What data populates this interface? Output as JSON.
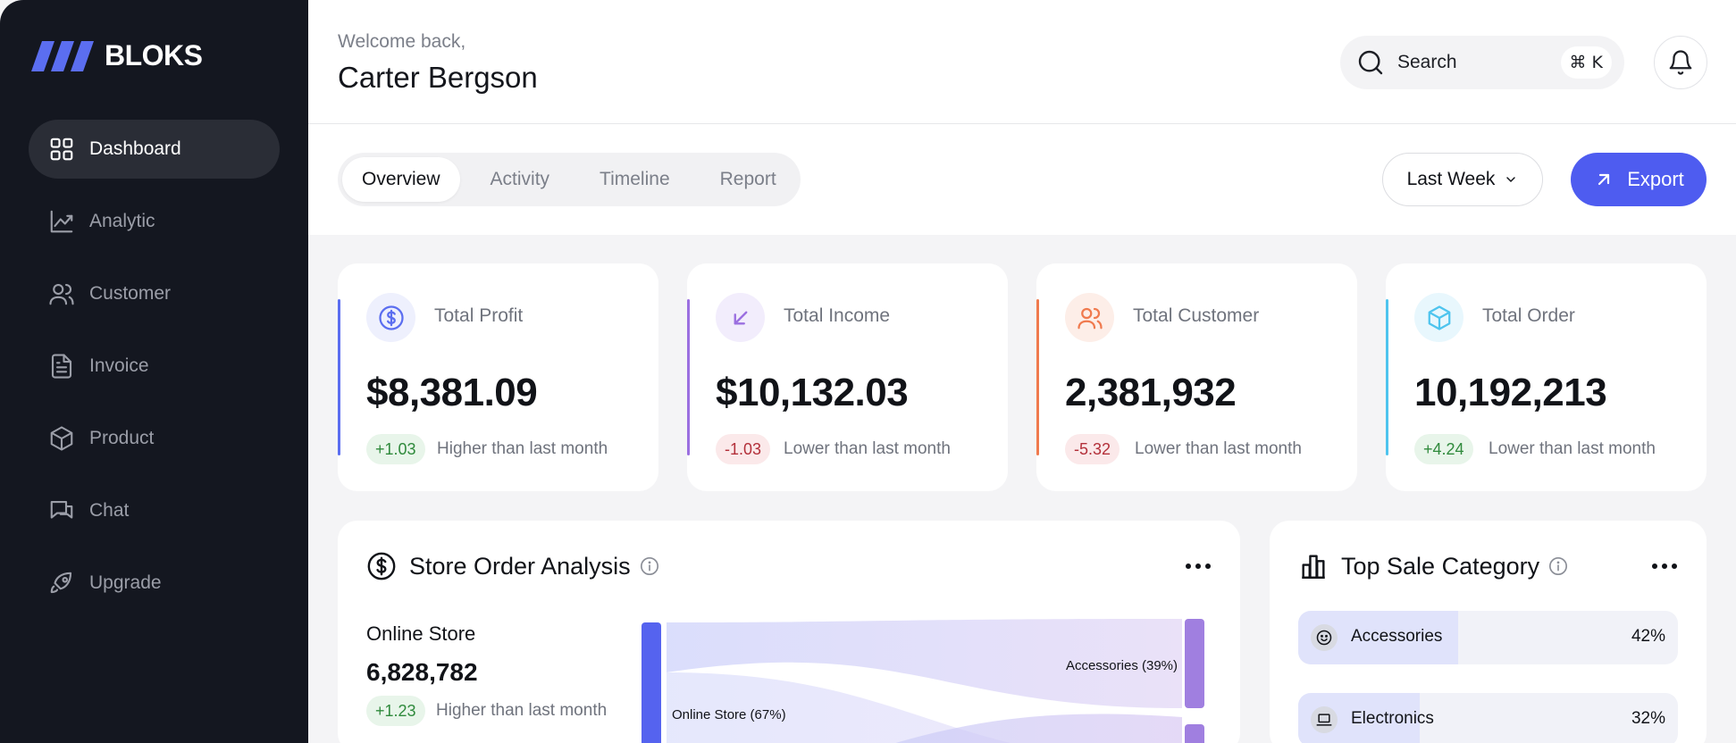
{
  "app": {
    "logo_text": "BLOKS",
    "brand_color": "#4e5cf0"
  },
  "sidebar": {
    "items": [
      {
        "label": "Dashboard",
        "icon": "grid-icon",
        "active": true
      },
      {
        "label": "Analytic",
        "icon": "trend-icon"
      },
      {
        "label": "Customer",
        "icon": "users-icon"
      },
      {
        "label": "Invoice",
        "icon": "document-icon"
      },
      {
        "label": "Product",
        "icon": "box-icon"
      },
      {
        "label": "Chat",
        "icon": "chat-icon"
      },
      {
        "label": "Upgrade",
        "icon": "rocket-icon"
      }
    ]
  },
  "header": {
    "welcome": "Welcome back,",
    "user_name": "Carter Bergson",
    "search_label": "Search",
    "search_shortcut": "⌘ K"
  },
  "toolbar": {
    "tabs": [
      {
        "label": "Overview",
        "active": true
      },
      {
        "label": "Activity"
      },
      {
        "label": "Timeline"
      },
      {
        "label": "Report"
      }
    ],
    "period": "Last Week",
    "export_label": "Export"
  },
  "stats": [
    {
      "title": "Total Profit",
      "value": "$8,381.09",
      "change": "+1.03",
      "note": "Higher than last month",
      "trend": "positive",
      "accent": "#5b6ef0",
      "icon": "dollar-icon"
    },
    {
      "title": "Total Income",
      "value": "$10,132.03",
      "change": "-1.03",
      "note": "Lower than last month",
      "trend": "negative",
      "accent": "#9b6fe0",
      "icon": "arrow-down-left-icon"
    },
    {
      "title": "Total Customer",
      "value": "2,381,932",
      "change": "-5.32",
      "note": "Lower than last month",
      "trend": "negative",
      "accent": "#f07a4e",
      "icon": "users-icon"
    },
    {
      "title": "Total Order",
      "value": "10,192,213",
      "change": "+4.24",
      "note": "Lower than last month",
      "trend": "positive",
      "accent": "#4ec4ee",
      "icon": "cube-icon"
    }
  ],
  "store_order": {
    "title": "Store Order Analysis",
    "store_label": "Online Store",
    "store_value": "6,828,782",
    "change": "+1.23",
    "note": "Higher than last month",
    "flow_source": "Online Store (67%)",
    "flow_target": "Accessories (39%)"
  },
  "top_sale": {
    "title": "Top Sale Category",
    "categories": [
      {
        "name": "Accessories",
        "percent": "42%",
        "share": 0.42,
        "icon": "smile-icon"
      },
      {
        "name": "Electronics",
        "percent": "32%",
        "share": 0.32,
        "icon": "laptop-icon"
      }
    ]
  }
}
